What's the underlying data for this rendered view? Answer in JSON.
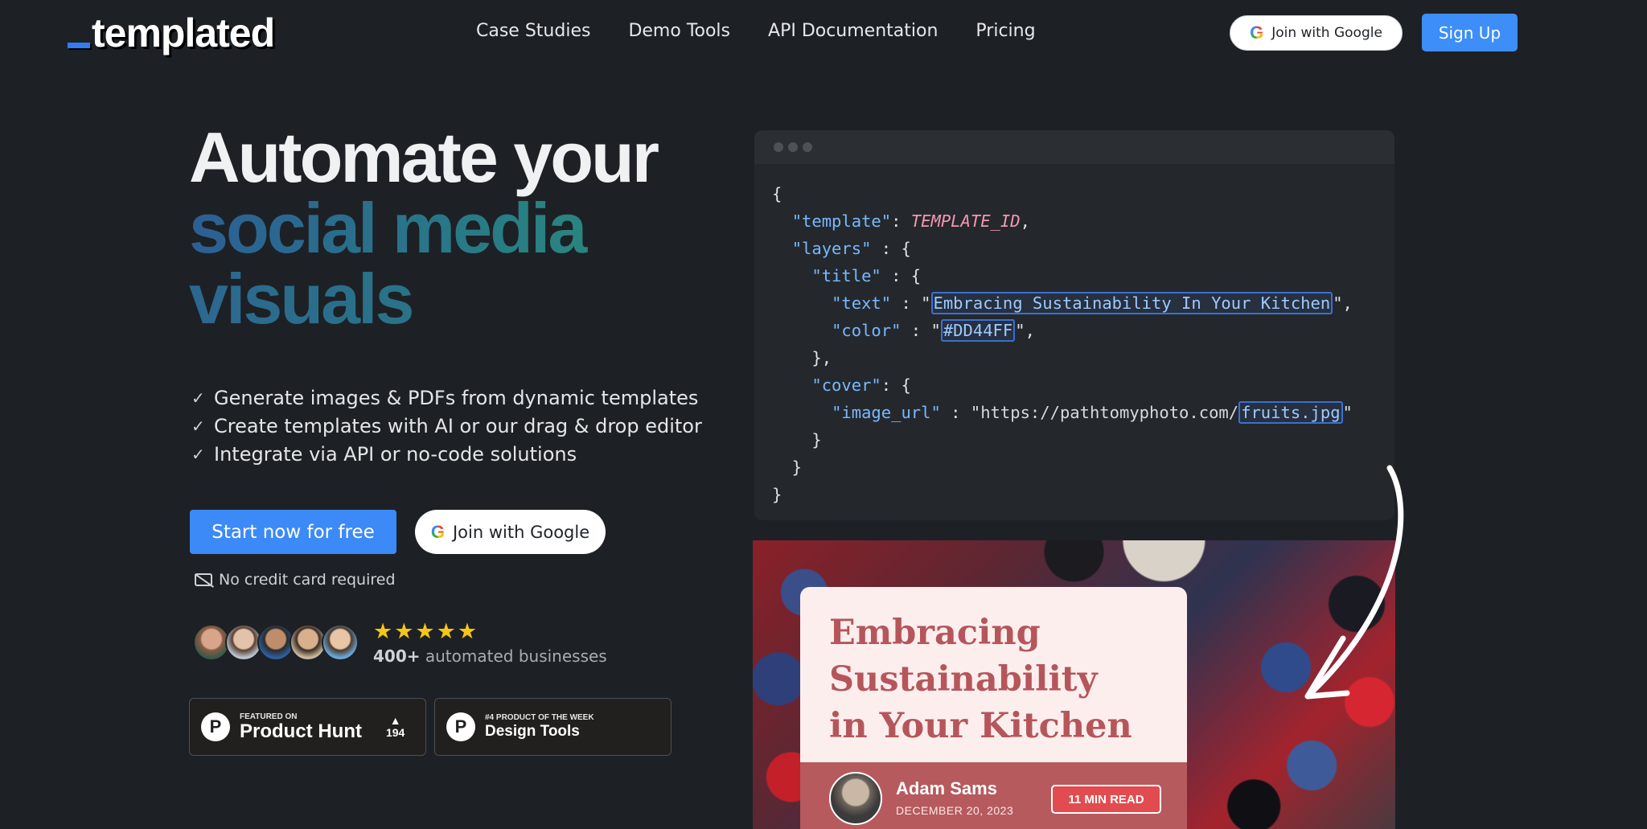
{
  "header": {
    "logo": "templated",
    "nav": [
      "Case Studies",
      "Demo Tools",
      "API Documentation",
      "Pricing"
    ],
    "google_label": "Join with Google",
    "signup_label": "Sign Up"
  },
  "hero": {
    "line1": "Automate your",
    "line2": "social media",
    "line3": "visuals",
    "features": [
      "Generate images & PDFs from dynamic templates",
      "Create templates with AI or our drag & drop editor",
      "Integrate via API or no-code solutions"
    ],
    "cta_primary": "Start now for free",
    "cta_google": "Join with Google",
    "no_card": "No credit card required",
    "rating_count": "400+",
    "rating_text": "automated businesses",
    "stars": "★★★★★"
  },
  "badges": {
    "ph_small": "FEATURED ON",
    "ph_big": "Product Hunt",
    "ph_votes": "194",
    "dt_small": "#4 PRODUCT OF THE WEEK",
    "dt_big": "Design Tools"
  },
  "code": {
    "template_key": "\"template\"",
    "template_val": "TEMPLATE_ID",
    "layers_key": "\"layers\"",
    "title_key": "\"title\"",
    "text_key": "\"text\"",
    "text_val": "Embracing Sustainability In Your Kitchen",
    "color_key": "\"color\"",
    "color_val": "#DD44FF",
    "cover_key": "\"cover\"",
    "image_key": "\"image_url\"",
    "image_prefix": "https://pathtomyphoto.com/",
    "image_file": "fruits.jpg"
  },
  "preview": {
    "title_l1": "Embracing",
    "title_l2": "Sustainability",
    "title_l3": "in Your Kitchen",
    "author": "Adam Sams",
    "date": "DECEMBER 20, 2023",
    "read": "11 MIN READ"
  },
  "colors": {
    "background": "#1d2125",
    "accent": "#3c8af7",
    "code_key": "#79b8ff",
    "code_value": "#f497b0",
    "card": "#fdeeee",
    "card_title": "#b5565b"
  }
}
